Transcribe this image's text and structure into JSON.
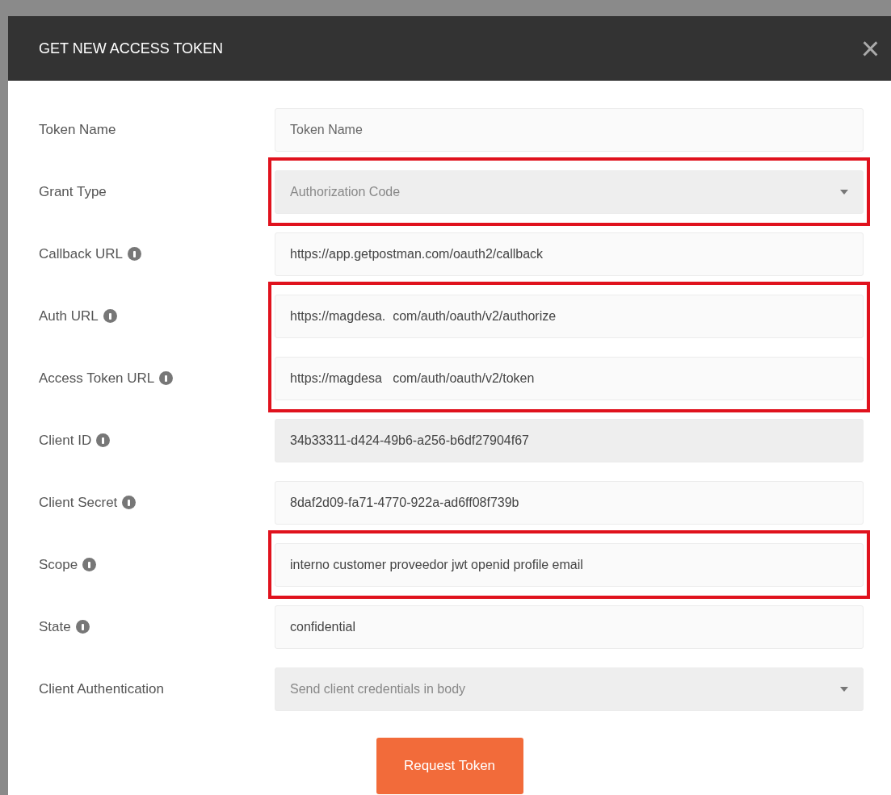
{
  "dialog": {
    "title": "GET NEW ACCESS TOKEN",
    "close": "×"
  },
  "fields": [
    {
      "label": "Token Name",
      "info": false,
      "kind": "input",
      "placeholder": "Token Name",
      "disabled": false,
      "highlighted": false
    },
    {
      "label": "Grant Type",
      "info": false,
      "kind": "select",
      "value": "Authorization Code",
      "disabled": false,
      "highlighted": true
    },
    {
      "label": "Callback URL",
      "info": true,
      "kind": "input",
      "value": "https://app.getpostman.com/oauth2/callback",
      "disabled": false,
      "highlighted": false
    },
    {
      "label": "Auth URL",
      "info": true,
      "kind": "input",
      "value": "https://magdesa.  com/auth/oauth/v2/authorize",
      "disabled": false,
      "highlighted": true
    },
    {
      "label": "Access Token URL",
      "info": true,
      "kind": "input",
      "value": "https://magdesa   com/auth/oauth/v2/token",
      "disabled": false,
      "highlighted": true
    },
    {
      "label": "Client ID",
      "info": true,
      "kind": "input",
      "value": "34b33311-d424-49b6-a256-b6df27904f67",
      "disabled": true,
      "highlighted": false
    },
    {
      "label": "Client Secret",
      "info": true,
      "kind": "input",
      "value": "8daf2d09-fa71-4770-922a-ad6ff08f739b",
      "disabled": false,
      "highlighted": false
    },
    {
      "label": "Scope",
      "info": true,
      "kind": "input",
      "value": "interno customer proveedor jwt openid profile email",
      "disabled": false,
      "highlighted": true
    },
    {
      "label": "State",
      "info": true,
      "kind": "input",
      "value": "confidential",
      "disabled": false,
      "highlighted": false
    },
    {
      "label": "Client Authentication",
      "info": false,
      "kind": "select",
      "value": "Send client credentials in body",
      "disabled": false,
      "highlighted": false
    }
  ],
  "submit": "Request Token"
}
